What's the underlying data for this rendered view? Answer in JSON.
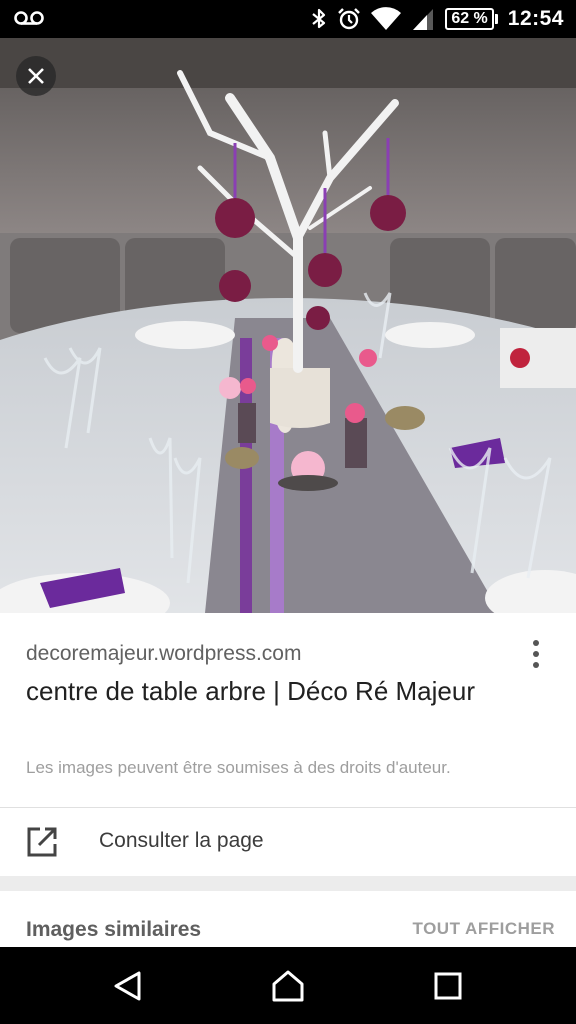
{
  "status_bar": {
    "time": "12:54",
    "battery": "62 %",
    "icons": [
      "voicemail-icon",
      "bluetooth-icon",
      "alarm-icon",
      "wifi-icon",
      "signal-icon",
      "battery-icon"
    ]
  },
  "viewer": {
    "close_icon": "close-icon"
  },
  "result": {
    "source": "decoremajeur.wordpress.com",
    "title": "centre de table arbre | Déco Ré Majeur",
    "copyright": "Les images peuvent être soumises à des droits d'auteur.",
    "menu_icon": "more-vert-icon"
  },
  "actions": {
    "visit_label": "Consulter la page",
    "visit_icon": "open-in-new-icon"
  },
  "similar": {
    "title": "Images similaires",
    "see_all": "TOUT AFFICHER"
  },
  "nav_bar": {
    "icons": [
      "back-icon",
      "home-icon",
      "recents-icon"
    ]
  }
}
